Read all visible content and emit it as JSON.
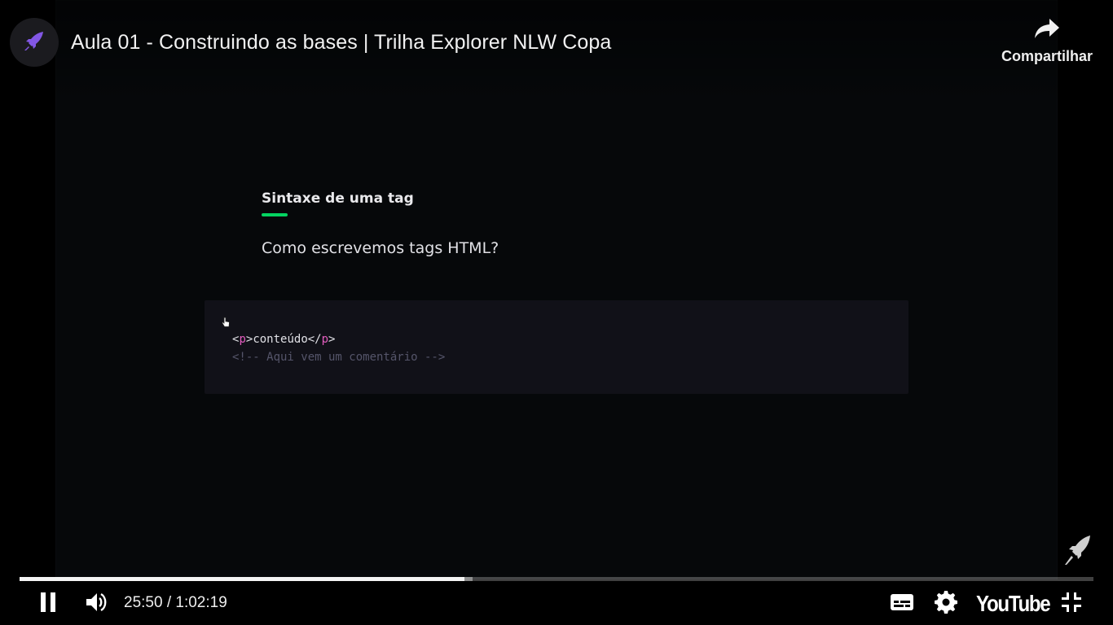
{
  "window": {
    "title": "Aula 01 - Construindo as bases | Trilha Explorer NLW Copa",
    "share_label": "Compartilhar"
  },
  "slide": {
    "heading": "Sintaxe de uma tag",
    "question": "Como escrevemos tags HTML?",
    "code": {
      "line1": {
        "open_lt": "<",
        "tag": "p",
        "open_gt": ">",
        "content": "conteúdo",
        "close_lt": "</",
        "close_tag": "p",
        "close_gt": ">"
      },
      "line2": "<!-- Aqui vem um comentário -->"
    }
  },
  "player": {
    "current_time": "25:50",
    "separator": " / ",
    "duration": "1:02:19",
    "progress_fraction": 0.4143,
    "buffered_fraction": 0.422,
    "logo_text": "YouTube"
  },
  "icons": {
    "channel": "rocket-icon",
    "share": "share-arrow-icon",
    "cursor": "hand-cursor-icon",
    "watermark": "rocket-icon",
    "pause": "pause-icon",
    "volume": "volume-icon",
    "subtitles": "subtitles-icon",
    "settings": "gear-icon",
    "exit_fullscreen": "exit-fullscreen-icon"
  },
  "colors": {
    "accent_green": "#04d361",
    "tag_pink": "#e35dbf",
    "rocket_purple": "#8257e5"
  }
}
